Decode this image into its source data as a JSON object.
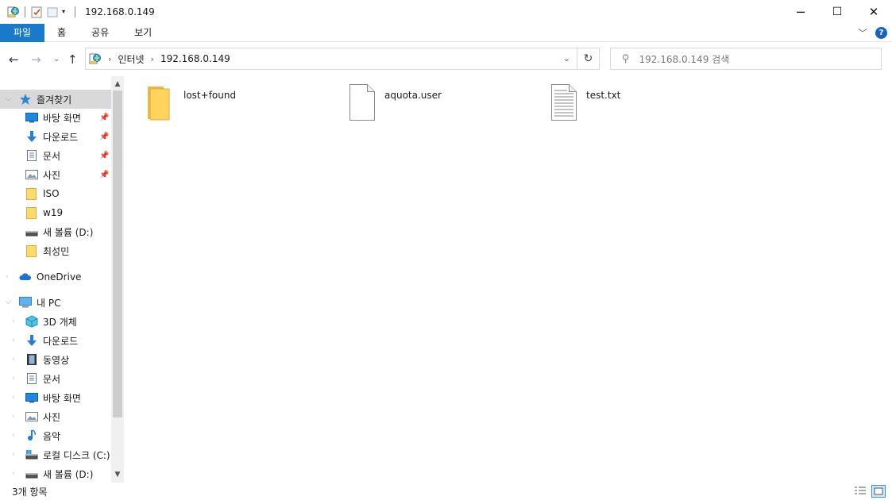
{
  "window": {
    "title": "192.168.0.149",
    "controls": {
      "minimize": "─",
      "maximize": "☐",
      "close": "✕"
    }
  },
  "ribbon": {
    "tabs": [
      {
        "label": "파일"
      },
      {
        "label": "홈"
      },
      {
        "label": "공유"
      },
      {
        "label": "보기"
      }
    ],
    "collapse_icon": "chevron-down-icon",
    "help_label": "?"
  },
  "address": {
    "crumbs": [
      "인터넷",
      "192.168.0.149"
    ],
    "search_placeholder": "192.168.0.149 검색"
  },
  "nav": {
    "quick_access": "즐겨찾기",
    "quick_items": [
      {
        "label": "바탕 화면",
        "icon": "desktop-icon",
        "pinned": true
      },
      {
        "label": "다운로드",
        "icon": "download-icon",
        "pinned": true
      },
      {
        "label": "문서",
        "icon": "document-icon",
        "pinned": true
      },
      {
        "label": "사진",
        "icon": "pictures-icon",
        "pinned": true
      },
      {
        "label": "ISO",
        "icon": "folder-icon",
        "pinned": false
      },
      {
        "label": "w19",
        "icon": "folder-icon",
        "pinned": false
      },
      {
        "label": "새 볼륨 (D:)",
        "icon": "drive-icon",
        "pinned": false
      },
      {
        "label": "최성민",
        "icon": "folder-icon",
        "pinned": false
      }
    ],
    "onedrive": "OneDrive",
    "this_pc": "내 PC",
    "pc_items": [
      {
        "label": "3D 개체",
        "icon": "3d-objects-icon"
      },
      {
        "label": "다운로드",
        "icon": "download-icon"
      },
      {
        "label": "동영상",
        "icon": "video-icon"
      },
      {
        "label": "문서",
        "icon": "document-icon"
      },
      {
        "label": "바탕 화면",
        "icon": "desktop-icon"
      },
      {
        "label": "사진",
        "icon": "pictures-icon"
      },
      {
        "label": "음악",
        "icon": "music-icon"
      },
      {
        "label": "로컬 디스크 (C:)",
        "icon": "local-disk-icon"
      },
      {
        "label": "새 볼륨 (D:)",
        "icon": "drive-icon"
      }
    ]
  },
  "files": [
    {
      "name": "lost+found",
      "type": "folder"
    },
    {
      "name": "aquota.user",
      "type": "file"
    },
    {
      "name": "test.txt",
      "type": "text"
    }
  ],
  "status": {
    "count": "3개 항목"
  },
  "colors": {
    "accent": "#1979ca",
    "selection": "#cce8ff",
    "folder": "#ffd96a"
  }
}
